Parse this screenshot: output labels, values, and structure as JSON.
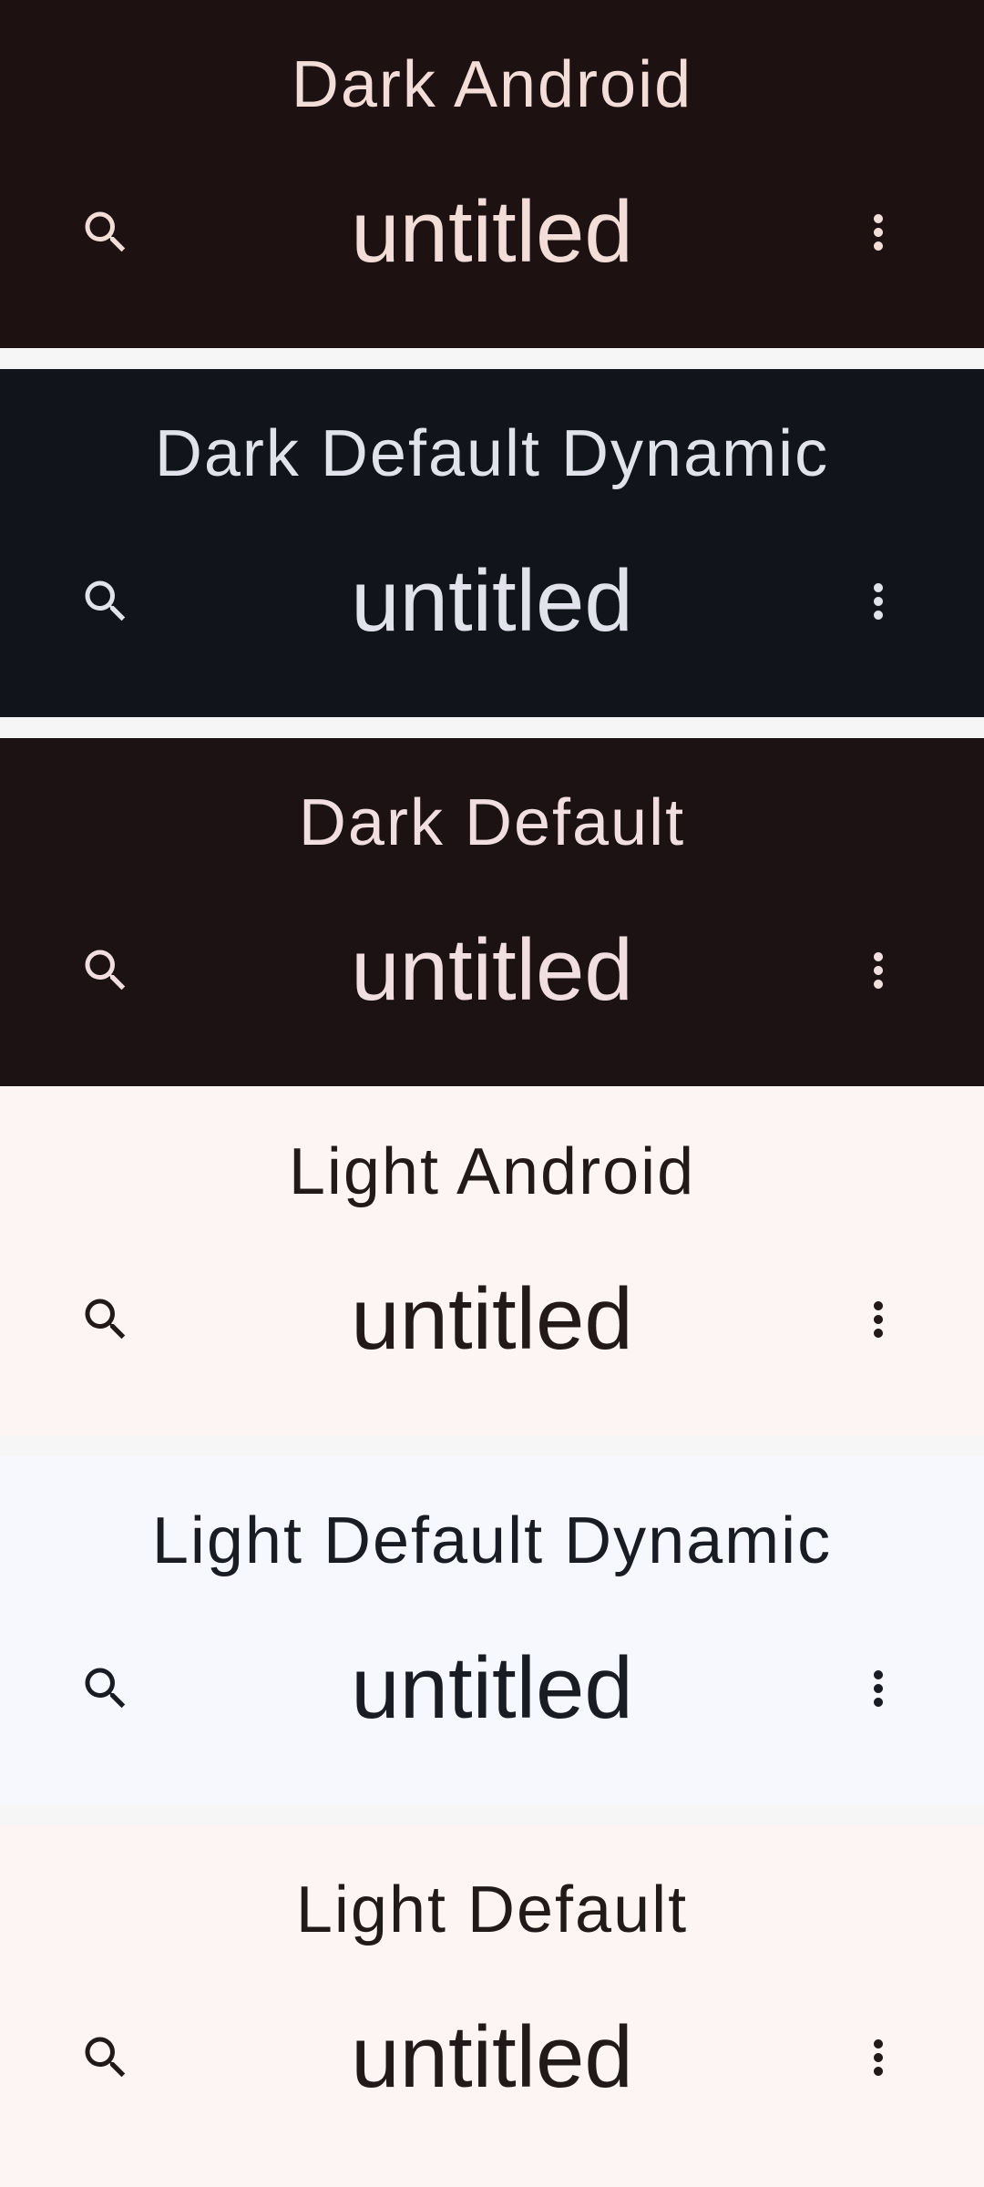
{
  "panels": [
    {
      "title": "Dark Android",
      "doc_title": "untitled",
      "colors": {
        "background": "#1d1211",
        "text": "#f3ddd8",
        "icon": "#f3ddd8"
      },
      "icons": {
        "left": "search-icon",
        "right": "more-vert-icon"
      }
    },
    {
      "title": "Dark Default Dynamic",
      "doc_title": "untitled",
      "colors": {
        "background": "#11141b",
        "text": "#e1e2eb",
        "icon": "#e1e2eb"
      },
      "icons": {
        "left": "search-icon",
        "right": "more-vert-icon"
      }
    },
    {
      "title": "Dark Default",
      "doc_title": "untitled",
      "colors": {
        "background": "#1c1214",
        "text": "#f1dee1",
        "icon": "#f1dee1"
      },
      "icons": {
        "left": "search-icon",
        "right": "more-vert-icon"
      }
    },
    {
      "title": "Light Android",
      "doc_title": "untitled",
      "colors": {
        "background": "#fdf5f3",
        "text": "#231918",
        "icon": "#231918"
      },
      "icons": {
        "left": "search-icon",
        "right": "more-vert-icon"
      }
    },
    {
      "title": "Light Default Dynamic",
      "doc_title": "untitled",
      "colors": {
        "background": "#f7f8fd",
        "text": "#191c22",
        "icon": "#191c22"
      },
      "icons": {
        "left": "search-icon",
        "right": "more-vert-icon"
      }
    },
    {
      "title": "Light Default",
      "doc_title": "untitled",
      "colors": {
        "background": "#fdf5f3",
        "text": "#211a1b",
        "icon": "#211a1b"
      },
      "icons": {
        "left": "search-icon",
        "right": "more-vert-icon"
      }
    }
  ]
}
